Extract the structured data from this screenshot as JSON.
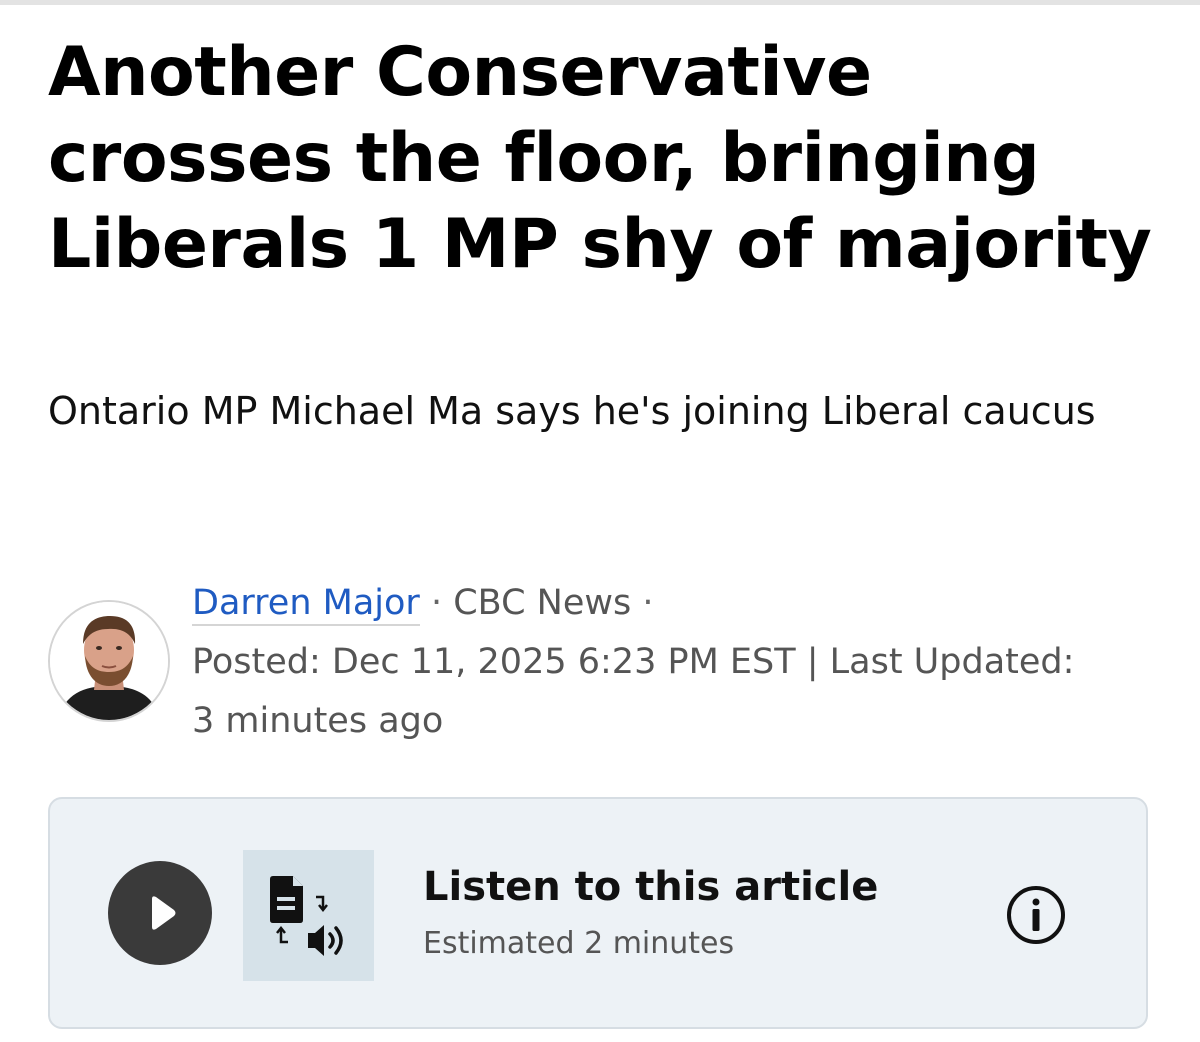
{
  "article": {
    "headline": "Another Conservative crosses the floor, bringing Liberals 1 MP shy of majority",
    "deck": "Ontario MP Michael Ma says he's joining Liberal caucus"
  },
  "byline": {
    "author": "Darren Major",
    "separator": "·",
    "outlet": "CBC News",
    "posted": "Posted: Dec 11, 2025 6:23 PM EST | Last Updated: 3 minutes ago"
  },
  "listen": {
    "title": "Listen to this article",
    "estimate": "Estimated 2 minutes"
  },
  "icons": {
    "play": "play-icon",
    "text_to_speech": "text-to-speech-icon",
    "info": "info-icon",
    "avatar": "author-avatar"
  },
  "colors": {
    "author_link": "#1f5bc2",
    "card_background": "#edf2f6",
    "tts_box_background": "#d6e2e9",
    "play_button": "#3a3a3a",
    "meta_text": "#555555"
  }
}
